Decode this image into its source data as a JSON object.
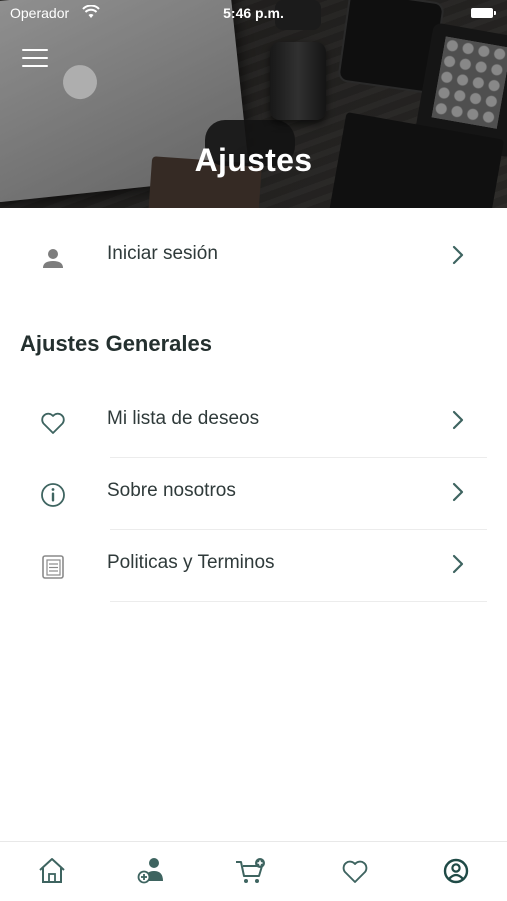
{
  "status_bar": {
    "carrier": "Operador",
    "time": "5:46 p.m."
  },
  "header": {
    "title": "Ajustes"
  },
  "login": {
    "label": "Iniciar sesión",
    "icon": "user-icon"
  },
  "general": {
    "title": "Ajustes Generales",
    "items": [
      {
        "label": "Mi lista de deseos",
        "icon": "heart-icon"
      },
      {
        "label": "Sobre nosotros",
        "icon": "info-icon"
      },
      {
        "label": "Politicas y Terminos",
        "icon": "document-icon"
      }
    ]
  },
  "tabbar": {
    "items": [
      "home-icon",
      "add-user-icon",
      "add-to-cart-icon",
      "heart-icon",
      "account-icon"
    ],
    "active": "account-icon"
  },
  "colors": {
    "accent": "#2f5c58",
    "icon_gray": "#7a7a7a",
    "chevron": "#3e6460"
  }
}
